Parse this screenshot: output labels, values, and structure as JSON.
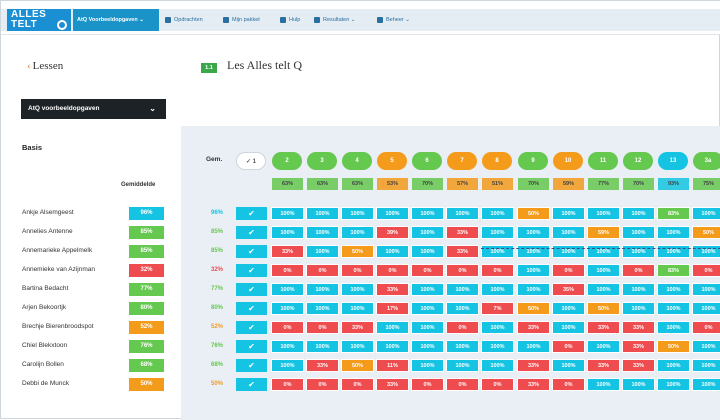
{
  "colors": {
    "cyan": "#14c4e2",
    "green": "#65c84f",
    "orange": "#f49b1c",
    "red": "#ee4c4f",
    "nav": "#1a93c9"
  },
  "topnav": {
    "logo_line1": "ALLES",
    "logo_line2": "TELT",
    "items": [
      {
        "label": "AtQ Voorbeeldopgaven ⌄",
        "icon": "none",
        "active": true
      },
      {
        "label": "Opdrachten",
        "icon": "clipboard-icon"
      },
      {
        "label": "Mijn pakket",
        "icon": "person-icon"
      },
      {
        "label": "Hulp",
        "icon": "help-icon"
      },
      {
        "label": "Resultaten ⌄",
        "icon": "chart-icon"
      },
      {
        "label": "Beheer ⌄",
        "icon": "gear-icon"
      }
    ]
  },
  "sidebar": {
    "back_label": "Lessen",
    "select_label": "AtQ voorbeeldopgaven",
    "group_label": "Basis",
    "avg_header": "Gemiddelde"
  },
  "lesson": {
    "badge": "1.1",
    "title": "Les Alles telt Q"
  },
  "grid": {
    "gem_label": "Gem.",
    "columns": [
      {
        "label": "✓ 1",
        "color": "white",
        "avg": ""
      },
      {
        "label": "2",
        "color": "green",
        "avg": "63%"
      },
      {
        "label": "3",
        "color": "green",
        "avg": "63%"
      },
      {
        "label": "4",
        "color": "green",
        "avg": "63%"
      },
      {
        "label": "5",
        "color": "orange",
        "avg": "53%"
      },
      {
        "label": "6",
        "color": "green",
        "avg": "70%"
      },
      {
        "label": "7",
        "color": "orange",
        "avg": "57%"
      },
      {
        "label": "8",
        "color": "orange",
        "avg": "51%"
      },
      {
        "label": "9",
        "color": "green",
        "avg": "70%"
      },
      {
        "label": "10",
        "color": "orange",
        "avg": "59%"
      },
      {
        "label": "11",
        "color": "green",
        "avg": "77%"
      },
      {
        "label": "12",
        "color": "green",
        "avg": "70%"
      },
      {
        "label": "13",
        "color": "cyan",
        "avg": "93%"
      },
      {
        "label": "3a",
        "color": "green",
        "avg": "75%"
      }
    ],
    "students": [
      {
        "name": "Ankje Alsemgeest",
        "avg": "96%",
        "color": "cyan",
        "cells": [
          [
            "100%",
            "c"
          ],
          [
            "100%",
            "c"
          ],
          [
            "100%",
            "c"
          ],
          [
            "100%",
            "c"
          ],
          [
            "100%",
            "c"
          ],
          [
            "100%",
            "c"
          ],
          [
            "100%",
            "c"
          ],
          [
            "50%",
            "o"
          ],
          [
            "100%",
            "c"
          ],
          [
            "100%",
            "c"
          ],
          [
            "100%",
            "c"
          ],
          [
            "83%",
            "g"
          ],
          [
            "100%",
            "c"
          ]
        ]
      },
      {
        "name": "Annelies Antenne",
        "avg": "85%",
        "color": "green",
        "cells": [
          [
            "100%",
            "c"
          ],
          [
            "100%",
            "c"
          ],
          [
            "100%",
            "c"
          ],
          [
            "39%",
            "r"
          ],
          [
            "100%",
            "c"
          ],
          [
            "33%",
            "r"
          ],
          [
            "100%",
            "c"
          ],
          [
            "100%",
            "c"
          ],
          [
            "100%",
            "c"
          ],
          [
            "59%",
            "o"
          ],
          [
            "100%",
            "c"
          ],
          [
            "100%",
            "c"
          ],
          [
            "50%",
            "o"
          ]
        ]
      },
      {
        "name": "Annemarieke Appelmelk",
        "avg": "85%",
        "color": "green",
        "cells": [
          [
            "33%",
            "r"
          ],
          [
            "100%",
            "c"
          ],
          [
            "50%",
            "o"
          ],
          [
            "100%",
            "c"
          ],
          [
            "100%",
            "c"
          ],
          [
            "33%",
            "r"
          ],
          [
            "100%",
            "c"
          ],
          [
            "100%",
            "c"
          ],
          [
            "100%",
            "c"
          ],
          [
            "100%",
            "c"
          ],
          [
            "100%",
            "c"
          ],
          [
            "100%",
            "c"
          ],
          [
            "100%",
            "c"
          ]
        ]
      },
      {
        "name": "Annemieke van Azijnman",
        "avg": "32%",
        "color": "red",
        "cells": [
          [
            "0%",
            "r"
          ],
          [
            "0%",
            "r"
          ],
          [
            "0%",
            "r"
          ],
          [
            "0%",
            "r"
          ],
          [
            "0%",
            "r"
          ],
          [
            "0%",
            "r"
          ],
          [
            "0%",
            "r"
          ],
          [
            "100%",
            "c"
          ],
          [
            "0%",
            "r"
          ],
          [
            "100%",
            "c"
          ],
          [
            "0%",
            "r"
          ],
          [
            "83%",
            "g"
          ],
          [
            "0%",
            "r"
          ]
        ]
      },
      {
        "name": "Bartina Bedacht",
        "avg": "77%",
        "color": "green",
        "cells": [
          [
            "100%",
            "c"
          ],
          [
            "100%",
            "c"
          ],
          [
            "100%",
            "c"
          ],
          [
            "33%",
            "r"
          ],
          [
            "100%",
            "c"
          ],
          [
            "100%",
            "c"
          ],
          [
            "100%",
            "c"
          ],
          [
            "100%",
            "c"
          ],
          [
            "35%",
            "r"
          ],
          [
            "100%",
            "c"
          ],
          [
            "100%",
            "c"
          ],
          [
            "100%",
            "c"
          ],
          [
            "100%",
            "c"
          ]
        ]
      },
      {
        "name": "Arjen Bekoortjk",
        "avg": "80%",
        "color": "green",
        "cells": [
          [
            "100%",
            "c"
          ],
          [
            "100%",
            "c"
          ],
          [
            "100%",
            "c"
          ],
          [
            "17%",
            "r"
          ],
          [
            "100%",
            "c"
          ],
          [
            "100%",
            "c"
          ],
          [
            "7%",
            "r"
          ],
          [
            "50%",
            "o"
          ],
          [
            "100%",
            "c"
          ],
          [
            "50%",
            "o"
          ],
          [
            "100%",
            "c"
          ],
          [
            "100%",
            "c"
          ],
          [
            "100%",
            "c"
          ]
        ]
      },
      {
        "name": "Brechje Bierenbroodspot",
        "avg": "52%",
        "color": "orange",
        "cells": [
          [
            "0%",
            "r"
          ],
          [
            "0%",
            "r"
          ],
          [
            "33%",
            "r"
          ],
          [
            "100%",
            "c"
          ],
          [
            "100%",
            "c"
          ],
          [
            "0%",
            "r"
          ],
          [
            "100%",
            "c"
          ],
          [
            "33%",
            "r"
          ],
          [
            "100%",
            "c"
          ],
          [
            "33%",
            "r"
          ],
          [
            "33%",
            "r"
          ],
          [
            "100%",
            "c"
          ],
          [
            "0%",
            "r"
          ]
        ]
      },
      {
        "name": "Chiel Blekxtoon",
        "avg": "76%",
        "color": "green",
        "cells": [
          [
            "100%",
            "c"
          ],
          [
            "100%",
            "c"
          ],
          [
            "100%",
            "c"
          ],
          [
            "100%",
            "c"
          ],
          [
            "100%",
            "c"
          ],
          [
            "100%",
            "c"
          ],
          [
            "100%",
            "c"
          ],
          [
            "100%",
            "c"
          ],
          [
            "0%",
            "r"
          ],
          [
            "100%",
            "c"
          ],
          [
            "33%",
            "r"
          ],
          [
            "50%",
            "o"
          ],
          [
            "100%",
            "c"
          ]
        ]
      },
      {
        "name": "Carolijn Bollen",
        "avg": "68%",
        "color": "green",
        "cells": [
          [
            "100%",
            "c"
          ],
          [
            "33%",
            "r"
          ],
          [
            "50%",
            "o"
          ],
          [
            "11%",
            "r"
          ],
          [
            "100%",
            "c"
          ],
          [
            "100%",
            "c"
          ],
          [
            "100%",
            "c"
          ],
          [
            "33%",
            "r"
          ],
          [
            "100%",
            "c"
          ],
          [
            "33%",
            "r"
          ],
          [
            "33%",
            "r"
          ],
          [
            "100%",
            "c"
          ],
          [
            "100%",
            "c"
          ]
        ]
      },
      {
        "name": "Debbi de Munck",
        "avg": "50%",
        "color": "orange",
        "cells": [
          [
            "0%",
            "r"
          ],
          [
            "0%",
            "r"
          ],
          [
            "0%",
            "r"
          ],
          [
            "33%",
            "r"
          ],
          [
            "0%",
            "r"
          ],
          [
            "0%",
            "r"
          ],
          [
            "0%",
            "r"
          ],
          [
            "33%",
            "r"
          ],
          [
            "0%",
            "r"
          ],
          [
            "100%",
            "c"
          ],
          [
            "100%",
            "c"
          ],
          [
            "100%",
            "c"
          ],
          [
            "100%",
            "c"
          ]
        ]
      }
    ]
  }
}
